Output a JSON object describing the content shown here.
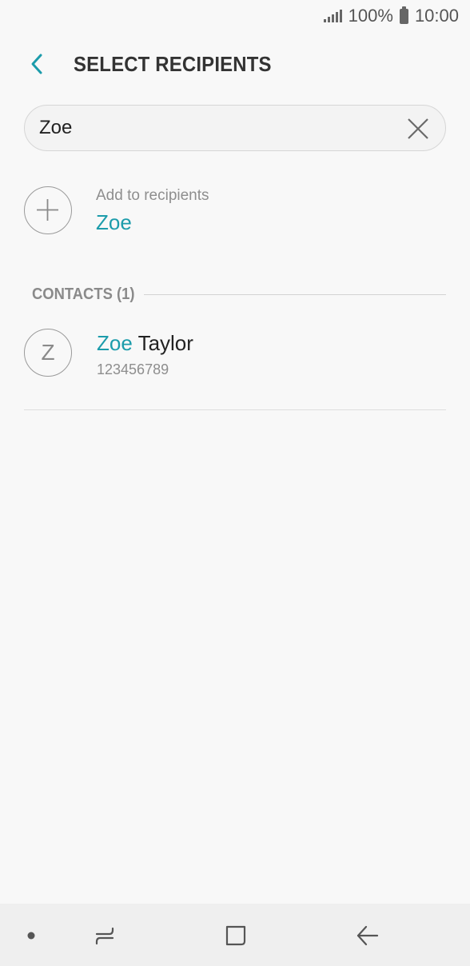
{
  "status_bar": {
    "battery_percent": "100%",
    "time": "10:00",
    "icons": [
      "signal-icon",
      "battery-icon"
    ]
  },
  "header": {
    "back_icon": "chevron-left-icon",
    "title": "SELECT RECIPIENTS"
  },
  "search": {
    "value": "Zoe",
    "clear_icon": "close-icon"
  },
  "add_recipient": {
    "icon": "plus-icon",
    "label": "Add to recipients",
    "name": "Zoe"
  },
  "contacts": {
    "section_title": "CONTACTS (1)",
    "items": [
      {
        "initial": "Z",
        "name_highlight": "Zoe",
        "name_rest": " Taylor",
        "number": "123456789"
      }
    ]
  },
  "nav_bar": {
    "icons": [
      "dot-icon",
      "recents-icon",
      "home-icon",
      "back-arrow-icon"
    ]
  },
  "colors": {
    "accent": "#1c9cab",
    "background": "#f8f8f8",
    "nav_background": "#efefef"
  }
}
